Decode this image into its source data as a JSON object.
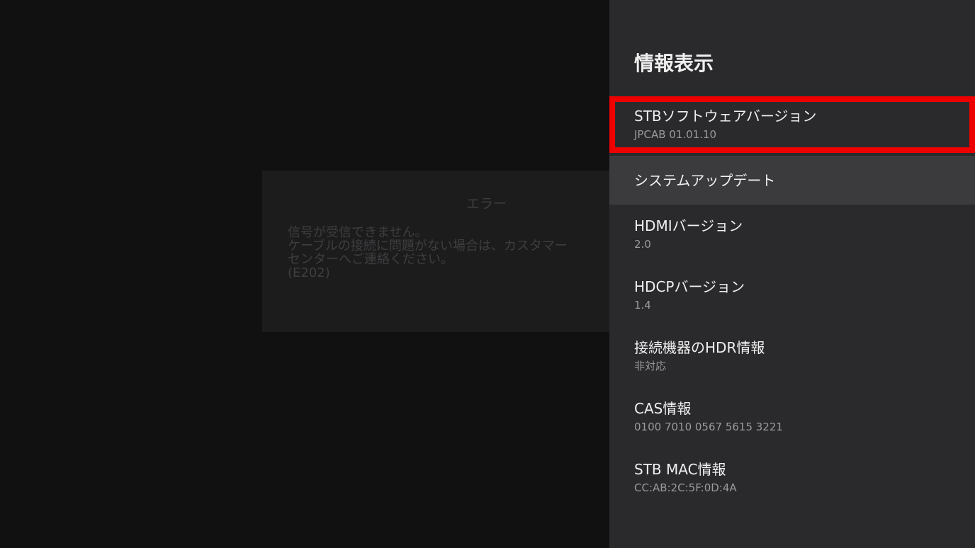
{
  "error_dialog": {
    "title": "エラー",
    "lines": [
      "信号が受信できません。",
      "ケーブルの接続に問題がない場合は、カスタマー",
      "センターへご連絡ください。",
      "(E202)"
    ]
  },
  "panel": {
    "title": "情報表示",
    "items": [
      {
        "label": "STBソフトウェアバージョン",
        "value": "JPCAB 01.01.10"
      },
      {
        "label": "システムアップデート",
        "value": ""
      },
      {
        "label": "HDMIバージョン",
        "value": "2.0"
      },
      {
        "label": "HDCPバージョン",
        "value": "1.4"
      },
      {
        "label": "接続機器のHDR情報",
        "value": "非対応"
      },
      {
        "label": "CAS情報",
        "value": "0100 7010 0567 5615 3221"
      },
      {
        "label": "STB MAC情報",
        "value": "CC:AB:2C:5F:0D:4A"
      }
    ],
    "focused_item": "システムアップデート",
    "highlighted_item": "STBソフトウェアバージョン",
    "highlight_color": "#ee0000"
  }
}
